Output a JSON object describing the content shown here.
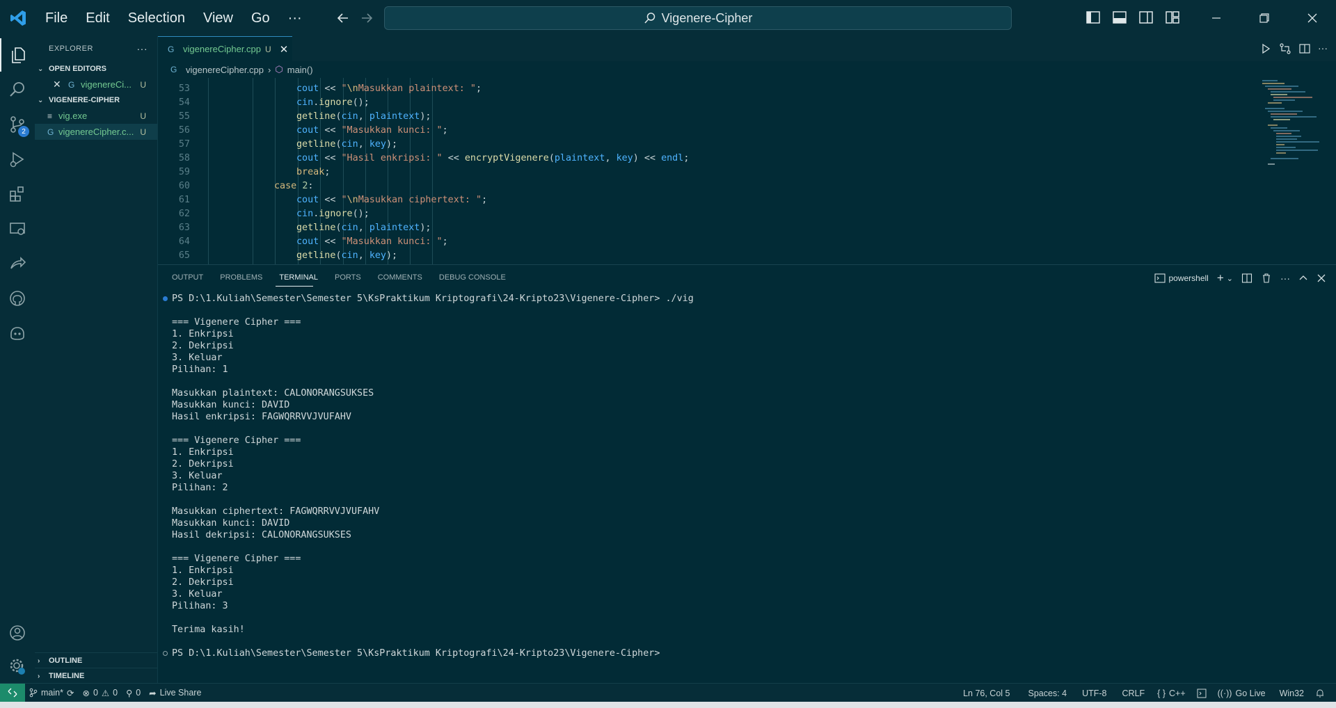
{
  "titlebar": {
    "menu": [
      "File",
      "Edit",
      "Selection",
      "View",
      "Go",
      "···"
    ],
    "search_text": "Vigenere-Cipher"
  },
  "activity": {
    "source_control_badge": "2"
  },
  "sidebar": {
    "title": "EXPLORER",
    "more": "···",
    "open_editors_label": "OPEN EDITORS",
    "open_editor_file": "vigenereCi...",
    "open_editor_status": "U",
    "folder_label": "VIGENERE-CIPHER",
    "files": [
      {
        "name": "vig.exe",
        "status": "U"
      },
      {
        "name": "vigenereCipher.c...",
        "status": "U"
      }
    ],
    "outline_label": "OUTLINE",
    "timeline_label": "TIMELINE"
  },
  "editor": {
    "tab_label": "vigenereCipher.cpp",
    "tab_status": "U",
    "breadcrumb_file": "vigenereCipher.cpp",
    "breadcrumb_symbol": "main()",
    "line_numbers": [
      "53",
      "54",
      "55",
      "56",
      "57",
      "58",
      "59",
      "60",
      "61",
      "62",
      "63",
      "64",
      "65"
    ]
  },
  "panel": {
    "tabs": [
      "OUTPUT",
      "PROBLEMS",
      "TERMINAL",
      "PORTS",
      "COMMENTS",
      "DEBUG CONSOLE"
    ],
    "active_tab": "TERMINAL",
    "shell": "powershell",
    "terminal_lines": [
      "PS D:\\1.Kuliah\\Semester\\Semester 5\\KsPraktikum Kriptografi\\24-Kripto23\\Vigenere-Cipher> ./vig",
      "",
      "=== Vigenere Cipher ===",
      "1. Enkripsi",
      "2. Dekripsi",
      "3. Keluar",
      "Pilihan: 1",
      "",
      "Masukkan plaintext: CALONORANGSUKSES",
      "Masukkan kunci: DAVID",
      "Hasil enkripsi: FAGWQRRVVJVUFAHV",
      "",
      "=== Vigenere Cipher ===",
      "1. Enkripsi",
      "2. Dekripsi",
      "3. Keluar",
      "Pilihan: 2",
      "",
      "Masukkan ciphertext: FAGWQRRVVJVUFAHV",
      "Masukkan kunci: DAVID",
      "Hasil dekripsi: CALONORANGSUKSES",
      "",
      "=== Vigenere Cipher ===",
      "1. Enkripsi",
      "2. Dekripsi",
      "3. Keluar",
      "Pilihan: 3",
      "",
      "Terima kasih!",
      "",
      "PS D:\\1.Kuliah\\Semester\\Semester 5\\KsPraktikum Kriptografi\\24-Kripto23\\Vigenere-Cipher>"
    ]
  },
  "statusbar": {
    "branch": "main*",
    "errors": "0",
    "warnings": "0",
    "ports": "0",
    "live_share": "Live Share",
    "position": "Ln 76, Col 5",
    "spaces": "Spaces: 4",
    "encoding": "UTF-8",
    "eol": "CRLF",
    "language": "C++",
    "go_live": "Go Live",
    "platform": "Win32"
  },
  "colors": {
    "background": "#022b36",
    "chrome": "#062d38",
    "accent": "#1c8b6b",
    "badge": "#2a7bd1"
  }
}
